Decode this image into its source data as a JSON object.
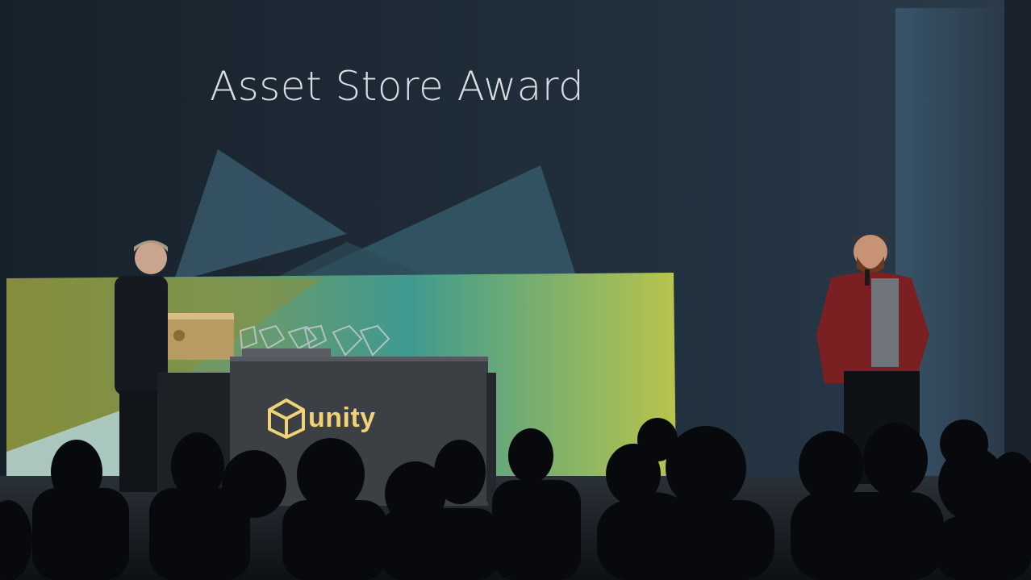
{
  "slide": {
    "title": "Asset Store Award"
  },
  "podium": {
    "brand_text": "unity",
    "brand_icon": "unity-logo-icon"
  },
  "colors": {
    "screen": "#1f2a33",
    "panel_left": "#8a8f3c",
    "panel_right": "#b8c34a",
    "panel_teal": "#3a8a8a",
    "podium": "#3c3f44",
    "brand_gold": "#f0d277",
    "jacket": "#7a1f22"
  }
}
